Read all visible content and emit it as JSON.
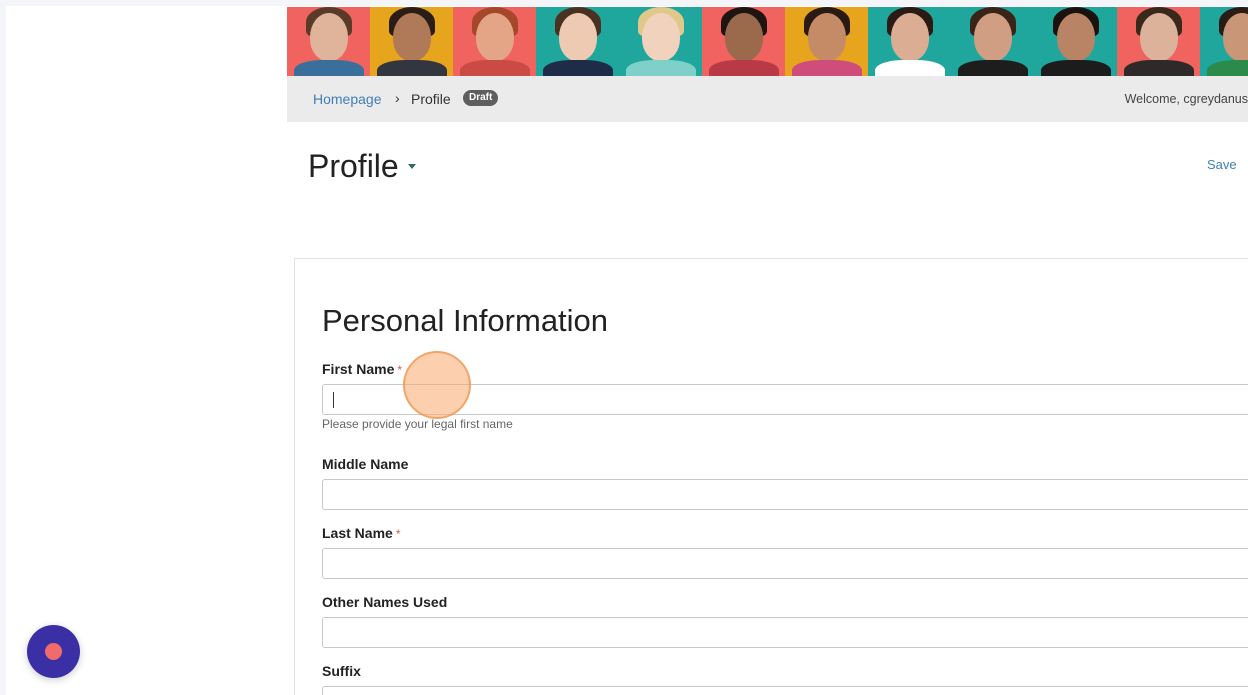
{
  "banner": {
    "tiles": [
      {
        "bg": "#f0635f",
        "skin": "#e0b49a",
        "hair": "#5a3b2a",
        "shirt": "#3a6f9c"
      },
      {
        "bg": "#e7a51e",
        "skin": "#b07a58",
        "hair": "#2a1d16",
        "shirt": "#34363f"
      },
      {
        "bg": "#f0635f",
        "skin": "#e3a586",
        "hair": "#a5482a",
        "shirt": "#c94b44"
      },
      {
        "bg": "#1fa79d",
        "skin": "#efcab2",
        "hair": "#4a3223",
        "shirt": "#1e2c48"
      },
      {
        "bg": "#1fa79d",
        "skin": "#f1d2bd",
        "hair": "#e0c88a",
        "shirt": "#7fd0c8"
      },
      {
        "bg": "#f0635f",
        "skin": "#9b6a4c",
        "hair": "#1e1511",
        "shirt": "#b83a46"
      },
      {
        "bg": "#e7a51e",
        "skin": "#c58a66",
        "hair": "#2b1a12",
        "shirt": "#cf4d7a"
      },
      {
        "bg": "#1fa79d",
        "skin": "#dbae94",
        "hair": "#2a1b14",
        "shirt": "#ffffff"
      },
      {
        "bg": "#1fa79d",
        "skin": "#d09e83",
        "hair": "#3a2418",
        "shirt": "#1d1d1d"
      },
      {
        "bg": "#1fa79d",
        "skin": "#b98465",
        "hair": "#1a120e",
        "shirt": "#1c1c1c"
      },
      {
        "bg": "#f0635f",
        "skin": "#dcb39a",
        "hair": "#3b281c",
        "shirt": "#2e2a2a"
      },
      {
        "bg": "#1fa79d",
        "skin": "#c99677",
        "hair": "#2a1c14",
        "shirt": "#2c8a4a"
      }
    ]
  },
  "breadcrumb": {
    "home": "Homepage",
    "separator": "›",
    "current": "Profile",
    "badge": "Draft"
  },
  "header": {
    "welcome": "Welcome, cgreydanus"
  },
  "page": {
    "title": "Profile",
    "save_label": "Save"
  },
  "form": {
    "section_title": "Personal Information",
    "required_marker": "*",
    "first_name_label": "First Name",
    "first_name_help": "Please provide your legal first name",
    "middle_name_label": "Middle Name",
    "last_name_label": "Last Name",
    "other_names_label": "Other Names Used",
    "suffix_label": "Suffix"
  },
  "colors": {
    "link": "#3f7fb8",
    "required": "#d9534f",
    "fab": "#3b2fa6",
    "fab_dot": "#f26b6b"
  },
  "icons": {
    "title_caret": "caret-down-icon",
    "fab": "chat-launcher-icon"
  }
}
